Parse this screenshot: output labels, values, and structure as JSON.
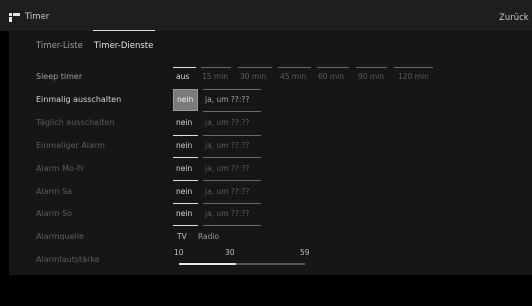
{
  "header": {
    "title": "Timer",
    "back_label": "Zurück"
  },
  "tabs": [
    {
      "label": "Timer-Liste",
      "selected": false
    },
    {
      "label": "Timer-Dienste",
      "selected": true
    }
  ],
  "rows": {
    "sleep_timer": {
      "label": "Sleep timer",
      "options": [
        "aus",
        "15 min",
        "30 min",
        "45 min",
        "60 min",
        "90 min",
        "120 min"
      ],
      "selected": "aus"
    },
    "einmalig_ausschalten": {
      "label": "Einmalig ausschalten",
      "options": [
        "nein",
        "ja, um ??:??"
      ],
      "selected": "nein"
    },
    "taeglich_ausschalten": {
      "label": "Täglich ausschalten",
      "options": [
        "nein",
        "ja, um ??:??"
      ],
      "selected": "nein"
    },
    "einmaliger_alarm": {
      "label": "Einmaliger Alarm",
      "options": [
        "nein",
        "ja, um ??:??"
      ],
      "selected": "nein"
    },
    "alarm_mo_fr": {
      "label": "Alarm Mo-Fr",
      "options": [
        "nein",
        "ja, um ??:??"
      ],
      "selected": "nein"
    },
    "alarm_sa": {
      "label": "Alarm Sa",
      "options": [
        "nein",
        "ja, um ??:??"
      ],
      "selected": "nein"
    },
    "alarm_so": {
      "label": "Alarm So",
      "options": [
        "nein",
        "ja, um ??:??"
      ],
      "selected": "nein"
    },
    "alarmquelle": {
      "label": "Alarmquelle",
      "options": [
        "TV",
        "Radio"
      ],
      "selected": "TV"
    },
    "alarmlautstaerke": {
      "label": "Alarmlautstärke",
      "scale": [
        "10",
        "30",
        "59"
      ],
      "fill_fraction": 0.45
    }
  },
  "colors": {
    "background": "#000000",
    "header_bar": "#1e1e1e",
    "panel": "#161616",
    "focus_box": "#7a7a7a",
    "selected_line": "#e0e0e0"
  },
  "icons": {
    "app": "timer-app-icon"
  }
}
